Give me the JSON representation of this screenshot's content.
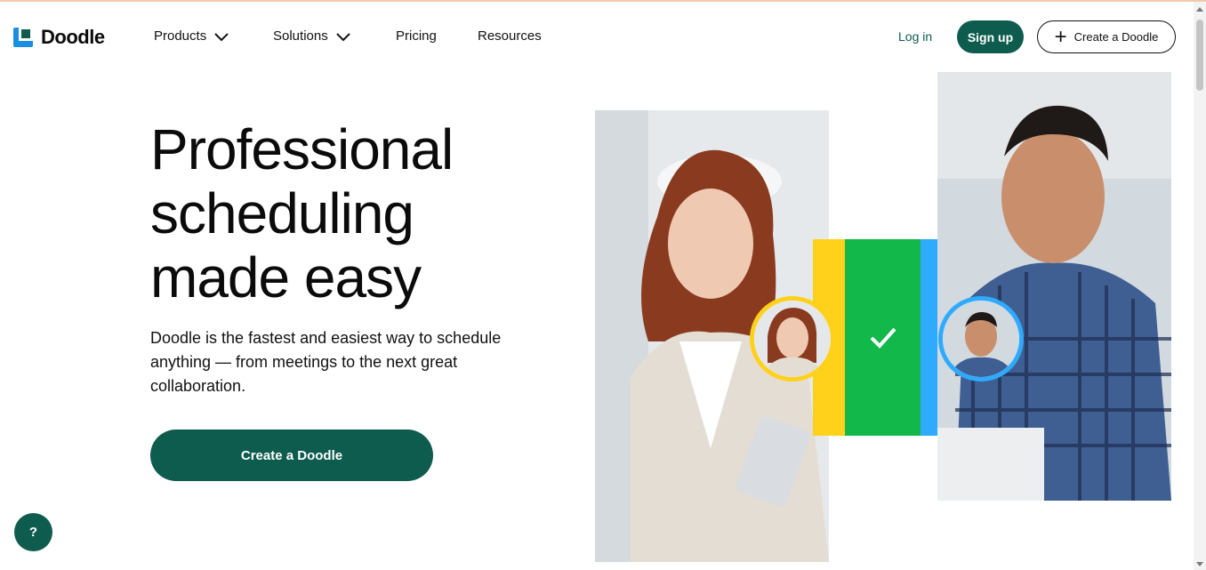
{
  "brand": {
    "name": "Doodle",
    "primary_color": "#0e5c4e",
    "accent_yellow": "#ffd11a",
    "accent_green": "#12b84a",
    "accent_blue": "#2eaaff"
  },
  "nav": {
    "items": [
      {
        "label": "Products",
        "has_dropdown": true
      },
      {
        "label": "Solutions",
        "has_dropdown": true
      },
      {
        "label": "Pricing",
        "has_dropdown": false
      },
      {
        "label": "Resources",
        "has_dropdown": false
      }
    ],
    "login_label": "Log in",
    "signup_label": "Sign up",
    "create_label": "Create a Doodle"
  },
  "hero": {
    "title": "Professional scheduling made easy",
    "subtitle": "Doodle is the fastest and easiest way to schedule anything — from meetings to the next great collaboration.",
    "cta_label": "Create a Doodle"
  },
  "help": {
    "label": "?"
  },
  "icons": {
    "logo": "doodle-logo-icon",
    "plus": "plus-icon",
    "chevron": "chevron-down-icon",
    "check": "check-icon"
  }
}
